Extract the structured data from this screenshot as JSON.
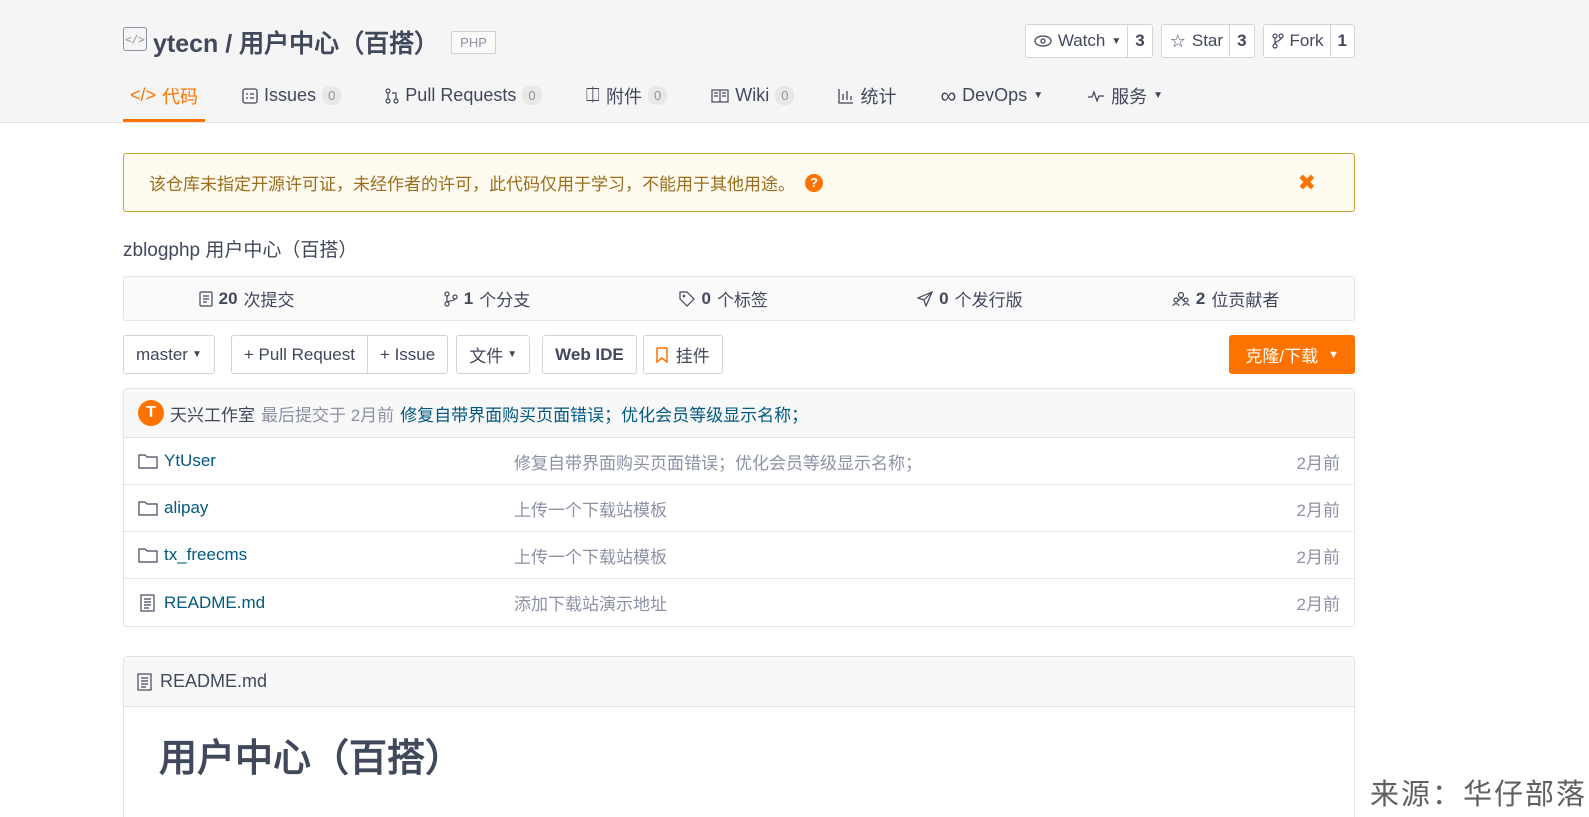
{
  "repo": {
    "title": "ytecn / 用户中心（百搭）",
    "language": "PHP",
    "description": "zblogphp 用户中心（百搭）"
  },
  "social": {
    "watch": {
      "label": "Watch",
      "count": "3"
    },
    "star": {
      "label": "Star",
      "count": "3"
    },
    "fork": {
      "label": "Fork",
      "count": "1"
    }
  },
  "tabs": [
    {
      "label": "代码",
      "icon": "code-icon",
      "active": true
    },
    {
      "label": "Issues",
      "badge": "0",
      "icon": "issues-icon"
    },
    {
      "label": "Pull Requests",
      "badge": "0",
      "icon": "pull-request-icon"
    },
    {
      "label": "附件",
      "badge": "0",
      "icon": "attachment-icon"
    },
    {
      "label": "Wiki",
      "badge": "0",
      "icon": "wiki-icon"
    },
    {
      "label": "统计",
      "icon": "stats-icon"
    },
    {
      "label": "DevOps",
      "icon": "infinity-icon"
    },
    {
      "label": "服务",
      "icon": "pulse-icon"
    }
  ],
  "notice": {
    "text": "该仓库未指定开源许可证，未经作者的许可，此代码仅用于学习，不能用于其他用途。"
  },
  "stats": [
    {
      "value": "20",
      "label": "次提交"
    },
    {
      "value": "1",
      "label": "个分支"
    },
    {
      "value": "0",
      "label": "个标签"
    },
    {
      "value": "0",
      "label": "个发行版"
    },
    {
      "value": "2",
      "label": "位贡献者"
    }
  ],
  "actions": {
    "branch": "master",
    "pull_request": "+ Pull Request",
    "issue": "+ Issue",
    "file": "文件",
    "web_ide": "Web IDE",
    "widget": "挂件",
    "clone": "克隆/下载"
  },
  "last_commit": {
    "avatar_text": "T",
    "author": "天兴工作室",
    "time": "最后提交于 2月前",
    "message": "修复自带界面购买页面错误；优化会员等级显示名称；"
  },
  "files": [
    {
      "name": "YtUser",
      "type": "folder",
      "message": "修复自带界面购买页面错误；优化会员等级显示名称；",
      "time": "2月前"
    },
    {
      "name": "alipay",
      "type": "folder",
      "message": "上传一个下载站模板",
      "time": "2月前"
    },
    {
      "name": "tx_freecms",
      "type": "folder",
      "message": "上传一个下载站模板",
      "time": "2月前"
    },
    {
      "name": "README.md",
      "type": "file",
      "message": "添加下载站演示地址",
      "time": "2月前"
    }
  ],
  "readme": {
    "filename": "README.md",
    "heading": "用户中心（百搭）"
  },
  "watermark": "来源：华仔部落",
  "colors": {
    "accent": "#fe7300",
    "link": "#005980",
    "notice_bg": "#fffaf0"
  }
}
